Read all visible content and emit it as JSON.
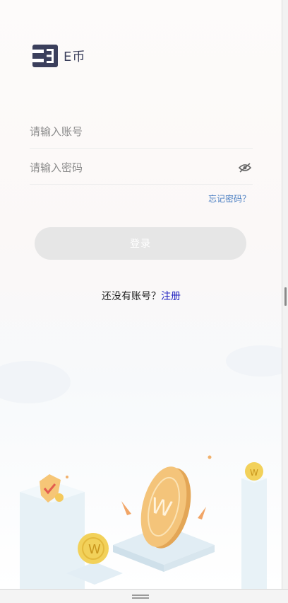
{
  "brand": {
    "name": "E币",
    "icon": "e-coin-logo-icon"
  },
  "login": {
    "account_placeholder": "请输入账号",
    "password_placeholder": "请输入密码",
    "password_toggle_icon": "eye-off-icon",
    "forgot_label": "忘记密码？",
    "submit_label": "登录",
    "no_account_text": "还没有账号？",
    "register_label": "注册"
  },
  "colors": {
    "brand_dark": "#3b3f5c",
    "link_blue": "#4a7ec2",
    "register_blue": "#2020c0",
    "button_disabled": "#e6e6e6",
    "coin_gold": "#f4c95c"
  }
}
